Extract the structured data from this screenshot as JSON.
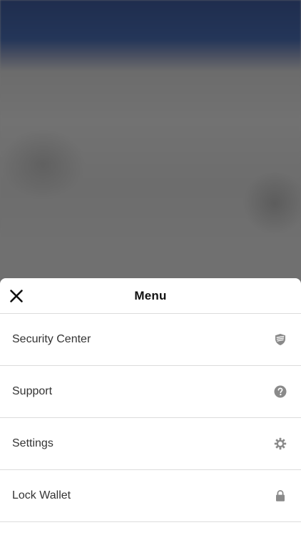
{
  "menu_sheet": {
    "title": "Menu",
    "items": [
      {
        "label": "Security Center",
        "icon": "shield-icon"
      },
      {
        "label": "Support",
        "icon": "question-circle-icon"
      },
      {
        "label": "Settings",
        "icon": "gear-icon"
      },
      {
        "label": "Lock Wallet",
        "icon": "lock-icon"
      }
    ]
  },
  "colors": {
    "backdrop_top": "#243659",
    "backdrop_overlay": "#6e6e6e",
    "icon": "#8a8a8a",
    "divider": "#dcdcdc"
  }
}
